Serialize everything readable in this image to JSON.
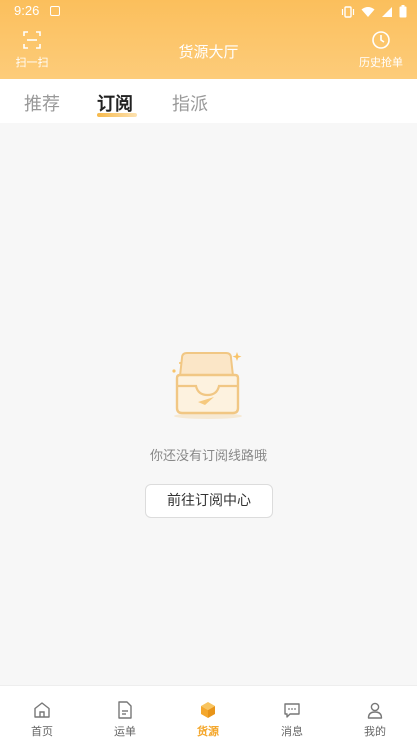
{
  "statusbar": {
    "time": "9:26"
  },
  "header": {
    "scan_label": "扫一扫",
    "title": "货源大厅",
    "history_label": "历史抢单"
  },
  "tabs": [
    {
      "label": "推荐",
      "active": false
    },
    {
      "label": "订阅",
      "active": true
    },
    {
      "label": "指派",
      "active": false
    }
  ],
  "empty": {
    "message": "你还没有订阅线路哦",
    "button_label": "前往订阅中心"
  },
  "bottom_nav": [
    {
      "label": "首页",
      "icon": "home-icon",
      "active": false
    },
    {
      "label": "运单",
      "icon": "document-icon",
      "active": false
    },
    {
      "label": "货源",
      "icon": "box-icon",
      "active": true
    },
    {
      "label": "消息",
      "icon": "chat-icon",
      "active": false
    },
    {
      "label": "我的",
      "icon": "user-icon",
      "active": false
    }
  ],
  "colors": {
    "accent": "#f4a72c",
    "header_gradient_top": "#fbbf5c",
    "header_gradient_bottom": "#fdcc7a"
  }
}
